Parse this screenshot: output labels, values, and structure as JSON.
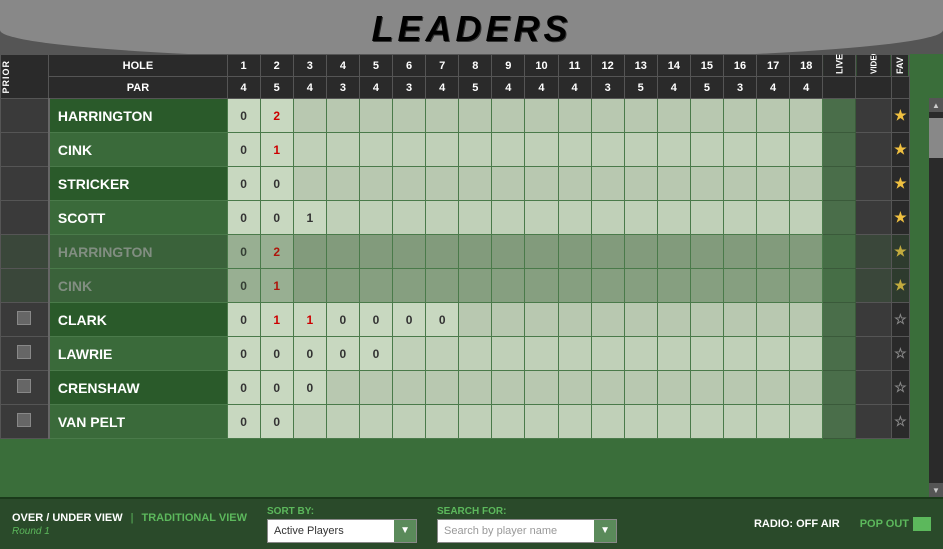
{
  "title": "LEADERS",
  "header": {
    "hole_label": "HOLE",
    "par_label": "PAR",
    "prior_label": "PRIOR",
    "holes": [
      "1",
      "2",
      "3",
      "4",
      "5",
      "6",
      "7",
      "8",
      "9",
      "10",
      "11",
      "12",
      "13",
      "14",
      "15",
      "16",
      "17",
      "18"
    ],
    "pars": [
      "4",
      "5",
      "4",
      "3",
      "4",
      "3",
      "4",
      "5",
      "4",
      "4",
      "4",
      "3",
      "5",
      "4",
      "5",
      "3",
      "4",
      "4"
    ],
    "live_label": "LIVE",
    "video_label": "VIDEO",
    "fav_label": "FAV"
  },
  "players": [
    {
      "name": "HARRINGTON",
      "grayed": false,
      "scores": [
        "0",
        "2",
        "",
        "",
        "",
        "",
        "",
        "",
        "",
        "",
        "",
        "",
        "",
        "",
        "",
        "",
        "",
        ""
      ],
      "score_colors": [
        "zero",
        "red",
        "",
        "",
        "",
        "",
        "",
        "",
        "",
        "",
        "",
        "",
        "",
        "",
        "",
        "",
        "",
        ""
      ],
      "live": "",
      "fav": "gold",
      "checkbox": false
    },
    {
      "name": "CINK",
      "grayed": false,
      "scores": [
        "0",
        "1",
        "",
        "",
        "",
        "",
        "",
        "",
        "",
        "",
        "",
        "",
        "",
        "",
        "",
        "",
        "",
        ""
      ],
      "score_colors": [
        "zero",
        "red",
        "",
        "",
        "",
        "",
        "",
        "",
        "",
        "",
        "",
        "",
        "",
        "",
        "",
        "",
        "",
        ""
      ],
      "live": "",
      "fav": "gold",
      "checkbox": false
    },
    {
      "name": "STRICKER",
      "grayed": false,
      "scores": [
        "0",
        "0",
        "",
        "",
        "",
        "",
        "",
        "",
        "",
        "",
        "",
        "",
        "",
        "",
        "",
        "",
        "",
        ""
      ],
      "score_colors": [
        "zero",
        "zero",
        "",
        "",
        "",
        "",
        "",
        "",
        "",
        "",
        "",
        "",
        "",
        "",
        "",
        "",
        "",
        ""
      ],
      "live": "",
      "fav": "gold",
      "checkbox": false
    },
    {
      "name": "SCOTT",
      "grayed": false,
      "scores": [
        "0",
        "0",
        "1",
        "",
        "",
        "",
        "",
        "",
        "",
        "",
        "",
        "",
        "",
        "",
        "",
        "",
        "",
        ""
      ],
      "score_colors": [
        "zero",
        "zero",
        "zero",
        "",
        "",
        "",
        "",
        "",
        "",
        "",
        "",
        "",
        "",
        "",
        "",
        "",
        "",
        ""
      ],
      "live": "",
      "fav": "gold",
      "checkbox": false
    },
    {
      "name": "HARRINGTON",
      "grayed": true,
      "scores": [
        "0",
        "2",
        "",
        "",
        "",
        "",
        "",
        "",
        "",
        "",
        "",
        "",
        "",
        "",
        "",
        "",
        "",
        ""
      ],
      "score_colors": [
        "zero",
        "red",
        "",
        "",
        "",
        "",
        "",
        "",
        "",
        "",
        "",
        "",
        "",
        "",
        "",
        "",
        "",
        ""
      ],
      "live": "",
      "fav": "gold",
      "checkbox": false
    },
    {
      "name": "CINK",
      "grayed": true,
      "scores": [
        "0",
        "1",
        "",
        "",
        "",
        "",
        "",
        "",
        "",
        "",
        "",
        "",
        "",
        "",
        "",
        "",
        "",
        ""
      ],
      "score_colors": [
        "zero",
        "red",
        "",
        "",
        "",
        "",
        "",
        "",
        "",
        "",
        "",
        "",
        "",
        "",
        "",
        "",
        "",
        ""
      ],
      "live": "",
      "fav": "gold",
      "checkbox": false
    },
    {
      "name": "CLARK",
      "grayed": false,
      "scores": [
        "0",
        "1",
        "1",
        "0",
        "0",
        "0",
        "0",
        "",
        "",
        "",
        "",
        "",
        "",
        "",
        "",
        "",
        "",
        ""
      ],
      "score_colors": [
        "zero",
        "red",
        "red",
        "zero",
        "zero",
        "zero",
        "zero",
        "",
        "",
        "",
        "",
        "",
        "",
        "",
        "",
        "",
        "",
        ""
      ],
      "live": "",
      "fav": "gray",
      "checkbox": true
    },
    {
      "name": "LAWRIE",
      "grayed": false,
      "scores": [
        "0",
        "0",
        "0",
        "0",
        "0",
        "",
        "",
        "",
        "",
        "",
        "",
        "",
        "",
        "",
        "",
        "",
        "",
        ""
      ],
      "score_colors": [
        "zero",
        "zero",
        "zero",
        "zero",
        "zero",
        "",
        "",
        "",
        "",
        "",
        "",
        "",
        "",
        "",
        "",
        "",
        "",
        ""
      ],
      "live": "",
      "fav": "gray",
      "checkbox": true
    },
    {
      "name": "CRENSHAW",
      "grayed": false,
      "scores": [
        "0",
        "0",
        "0",
        "",
        "",
        "",
        "",
        "",
        "",
        "",
        "",
        "",
        "",
        "",
        "",
        "",
        "",
        ""
      ],
      "score_colors": [
        "zero",
        "zero",
        "zero",
        "",
        "",
        "",
        "",
        "",
        "",
        "",
        "",
        "",
        "",
        "",
        "",
        "",
        "",
        ""
      ],
      "live": "",
      "fav": "gray",
      "checkbox": true
    },
    {
      "name": "VAN PELT",
      "grayed": false,
      "scores": [
        "0",
        "0",
        "",
        "",
        "",
        "",
        "",
        "",
        "",
        "",
        "",
        "",
        "",
        "",
        "",
        "",
        "",
        ""
      ],
      "score_colors": [
        "zero",
        "zero",
        "",
        "",
        "",
        "",
        "",
        "",
        "",
        "",
        "",
        "",
        "",
        "",
        "",
        "",
        "",
        ""
      ],
      "live": "",
      "fav": "gray",
      "checkbox": true
    }
  ],
  "footer": {
    "over_under_label": "OVER / UNDER VIEW",
    "traditional_label": "TRADITIONAL VIEW",
    "separator": "|",
    "round_label": "Round 1",
    "sort_label": "SORT BY:",
    "sort_value": "Active Players",
    "search_label": "SEARCH FOR:",
    "search_placeholder": "Search by player name",
    "radio_label": "RADIO: OFF AIR",
    "popout_label": "POP OUT"
  }
}
